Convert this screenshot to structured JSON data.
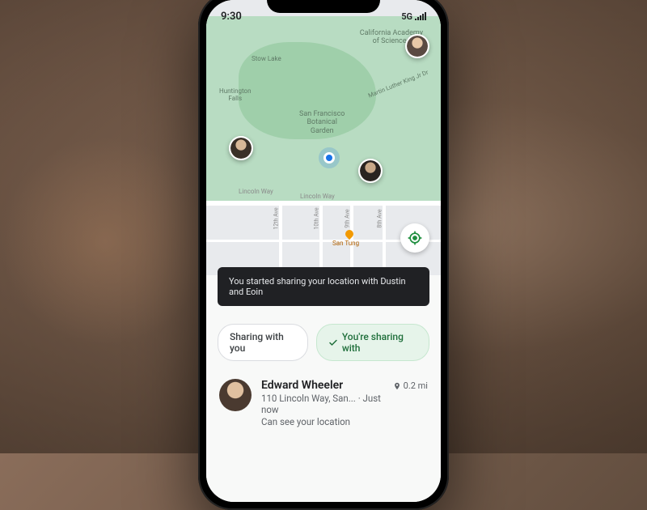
{
  "status": {
    "time": "9:30",
    "network": "5G"
  },
  "map": {
    "labels": {
      "academy": "California Academy\nof Sciences",
      "garden": "San Francisco\nBotanical\nGarden",
      "stow": "Stow Lake",
      "huntington": "Huntington\nFalls",
      "mlk": "Martin Luther King Jr Dr",
      "lincoln1": "Lincoln Way",
      "lincoln2": "Lincoln Way",
      "ave12": "12th Ave",
      "ave10": "10th Ave",
      "ave9": "9th Ave",
      "ave8": "8th Ave",
      "santung": "San Tung"
    }
  },
  "toast": {
    "message": "You started sharing your location with Dustin and Eoin"
  },
  "tabs": {
    "with_you": "Sharing with you",
    "you_sharing": "You're sharing with"
  },
  "contact": {
    "name": "Edward Wheeler",
    "address": "110 Lincoln Way, San... · Just now",
    "sub": "Can see your location",
    "distance": "0.2 mi"
  }
}
